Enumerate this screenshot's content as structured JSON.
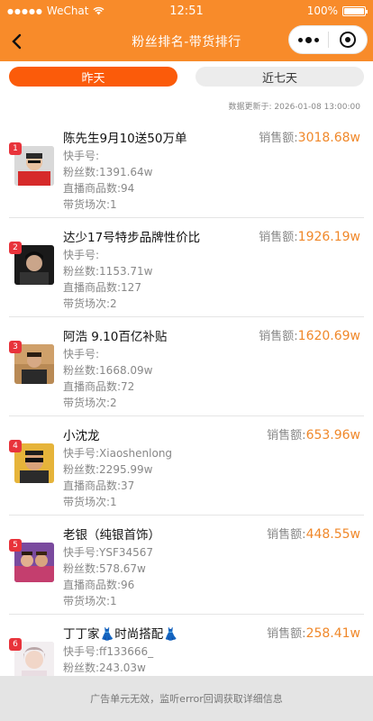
{
  "status_bar": {
    "carrier": "WeChat",
    "time": "12:51",
    "battery": "100%",
    "battery_level": 1.0
  },
  "nav": {
    "title": "粉丝排名-带货排行"
  },
  "tabs": [
    {
      "label": "昨天",
      "active": true
    },
    {
      "label": "近七天",
      "active": false
    }
  ],
  "update_time": "数据更新于: 2026-01-08 13:00:00",
  "labels": {
    "sales": "销售额:",
    "kuaishou": "快手号:",
    "fans": "粉丝数:",
    "goods": "直播商品数:",
    "sessions": "带货场次:"
  },
  "ranking": [
    {
      "rank": "1",
      "name": "陈先生9月10送50万单",
      "sales": "3018.68w",
      "kuaishou_id": "",
      "fans": "1391.64w",
      "goods": "94",
      "sessions": "1"
    },
    {
      "rank": "2",
      "name": "达少17号特步品牌性价比",
      "sales": "1926.19w",
      "kuaishou_id": "",
      "fans": "1153.71w",
      "goods": "127",
      "sessions": "2"
    },
    {
      "rank": "3",
      "name": "阿浩 9.10百亿补贴",
      "sales": "1620.69w",
      "kuaishou_id": "",
      "fans": "1668.09w",
      "goods": "72",
      "sessions": "2"
    },
    {
      "rank": "4",
      "name": "小沈龙",
      "sales": "653.96w",
      "kuaishou_id": "Xiaoshenlong",
      "fans": "2295.99w",
      "goods": "37",
      "sessions": "1"
    },
    {
      "rank": "5",
      "name": "老银（纯银首饰）",
      "sales": "448.55w",
      "kuaishou_id": "YSF34567",
      "fans": "578.67w",
      "goods": "96",
      "sessions": "1"
    },
    {
      "rank": "6",
      "name": "丁丁家👗时尚搭配👗",
      "sales": "258.41w",
      "kuaishou_id": "ff133666_",
      "fans": "243.03w",
      "goods": "",
      "sessions": ""
    }
  ],
  "ad_text": "广告单元无效，监听error回调获取详细信息",
  "colors": {
    "brand": "#f88b2a",
    "tab_active": "#fb5b0a",
    "rank_badge": "#e8333b",
    "sales_value": "#f0882a"
  }
}
